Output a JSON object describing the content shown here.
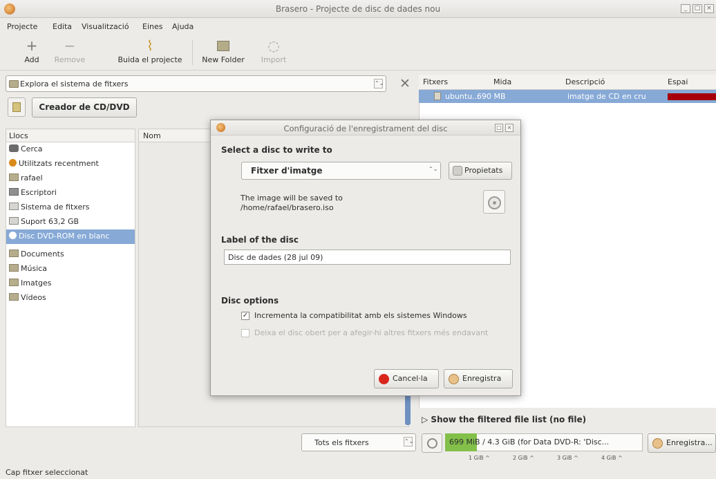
{
  "window": {
    "title": "Brasero - Projecte de disc de dades nou"
  },
  "menu": [
    "Projecte",
    "Edita",
    "Visualització",
    "Eines",
    "Ajuda"
  ],
  "toolbar": {
    "add": "Add",
    "remove": "Remove",
    "empty": "Buida el projecte",
    "new_folder": "New Folder",
    "import": "Import"
  },
  "explorer": {
    "combo": "Explora el sistema de fitxers"
  },
  "creator_button": "Creador de CD/DVD",
  "places": {
    "header": "Llocs",
    "items": [
      "Cerca",
      "Utilitzats recentment",
      "rafael",
      "Escriptori",
      "Sistema de fitxers",
      "Suport 63,2 GB",
      "Disc DVD-ROM en blanc",
      "Documents",
      "Música",
      "Imatges",
      "Vídeos"
    ],
    "selected_index": 6
  },
  "name_column": "Nom",
  "project_files": {
    "headers": [
      "Fitxers",
      "Mida",
      "Descripció",
      "Espai"
    ],
    "rows": [
      {
        "name": "ubuntu...",
        "size": "690 MB",
        "desc": "imatge de CD en cru"
      }
    ]
  },
  "filtered_toggle": "Show the filtered file list (no file)",
  "bottom": {
    "filter": "Tots els fitxers",
    "capacity": "699 MiB / 4.3 GiB (for Data DVD-R: 'Disc...",
    "ticks": [
      "1 GiB ^",
      "2 GiB ^",
      "3 GiB ^",
      "4 GiB ^"
    ],
    "burn": "Enregistra..."
  },
  "status": "Cap fitxer seleccionat",
  "dialog": {
    "title": "Configuració de l'enregistrament del disc",
    "select_heading": "Select a disc to write to",
    "target": "Fitxer d'imatge",
    "properties": "Propietats",
    "save_line1": "The image will be saved to",
    "save_line2": "/home/rafael/brasero.iso",
    "label_heading": "Label of the disc",
    "label_value": "Disc de dades (28 jul 09)",
    "options_heading": "Disc options",
    "option1": "Incrementa la compatibilitat amb els sistemes Windows",
    "option2": "Deixa el disc obert per a afegir-hi altres fitxers més endavant",
    "cancel": "Cancel·la",
    "burn": "Enregistra"
  }
}
